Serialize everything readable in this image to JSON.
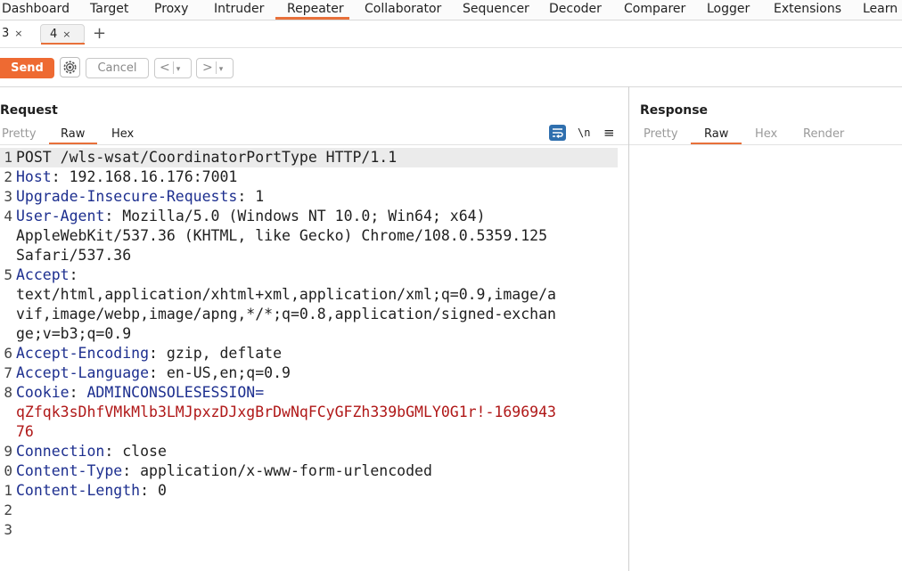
{
  "nav": {
    "tabs": [
      "Dashboard",
      "Target",
      "Proxy",
      "Intruder",
      "Repeater",
      "Collaborator",
      "Sequencer",
      "Decoder",
      "Comparer",
      "Logger",
      "Extensions",
      "Learn"
    ],
    "active": "Repeater"
  },
  "subtabs": {
    "tab3": "3",
    "tab4": "4",
    "close": "×",
    "add": "+"
  },
  "toolbar": {
    "send": "Send",
    "cancel": "Cancel",
    "back": "<",
    "forward": ">",
    "dropdown": "▾"
  },
  "request": {
    "title": "Request",
    "tabs": [
      "Pretty",
      "Raw",
      "Hex"
    ],
    "active_tab": "Raw",
    "newline_toggle": "\\n",
    "menu": "≡"
  },
  "response": {
    "title": "Response",
    "tabs": [
      "Pretty",
      "Raw",
      "Hex",
      "Render"
    ],
    "active_tab": "Raw"
  },
  "editor": {
    "line_numbers": [
      "1",
      "2",
      "3",
      "4",
      "5",
      "6",
      "7",
      "8",
      "9",
      "0",
      "1",
      "2",
      "3"
    ],
    "lines": [
      {
        "num": "1",
        "text": "POST /wls-wsat/CoordinatorPortType HTTP/1.1"
      },
      {
        "num": "2",
        "name": "Host",
        "value": "192.168.16.176:7001"
      },
      {
        "num": "3",
        "name": "Upgrade-Insecure-Requests",
        "value": "1"
      },
      {
        "num": "4",
        "name": "User-Agent",
        "value": "Mozilla/5.0 (Windows NT 10.0; Win64; x64)"
      },
      {
        "cont": "AppleWebKit/537.36 (KHTML, like Gecko) Chrome/108.0.5359.125"
      },
      {
        "cont": "Safari/537.36"
      },
      {
        "num": "5",
        "name": "Accept",
        "value": ""
      },
      {
        "cont": "text/html,application/xhtml+xml,application/xml;q=0.9,image/a"
      },
      {
        "cont": "vif,image/webp,image/apng,*/*;q=0.8,application/signed-exchan"
      },
      {
        "cont": "ge;v=b3;q=0.9"
      },
      {
        "num": "6",
        "name": "Accept-Encoding",
        "value": "gzip, deflate"
      },
      {
        "num": "7",
        "name": "Accept-Language",
        "value": "en-US,en;q=0.9"
      },
      {
        "num": "8",
        "name": "Cookie",
        "value": "",
        "cookie_name": "ADMINCONSOLESESSION="
      },
      {
        "cookie": "qZfqk3sDhfVMkMlb3LMJpxzDJxgBrDwNqFCyGFZh339bGMLY0G1r!-1696943"
      },
      {
        "cookie": "76"
      },
      {
        "num": "9",
        "name": "Connection",
        "value": "close"
      },
      {
        "num": "0",
        "name": "Content-Type",
        "value": "application/x-www-form-urlencoded"
      },
      {
        "num": "1",
        "name": "Content-Length",
        "value": "0"
      },
      {
        "num": "2",
        "text": ""
      },
      {
        "num": "3",
        "text": ""
      }
    ]
  },
  "colors": {
    "accent": "#e8703a",
    "send": "#ee6a32",
    "header_name": "#1d2f8f",
    "cookie_value": "#b01818",
    "wrap_icon": "#2f6fae"
  }
}
